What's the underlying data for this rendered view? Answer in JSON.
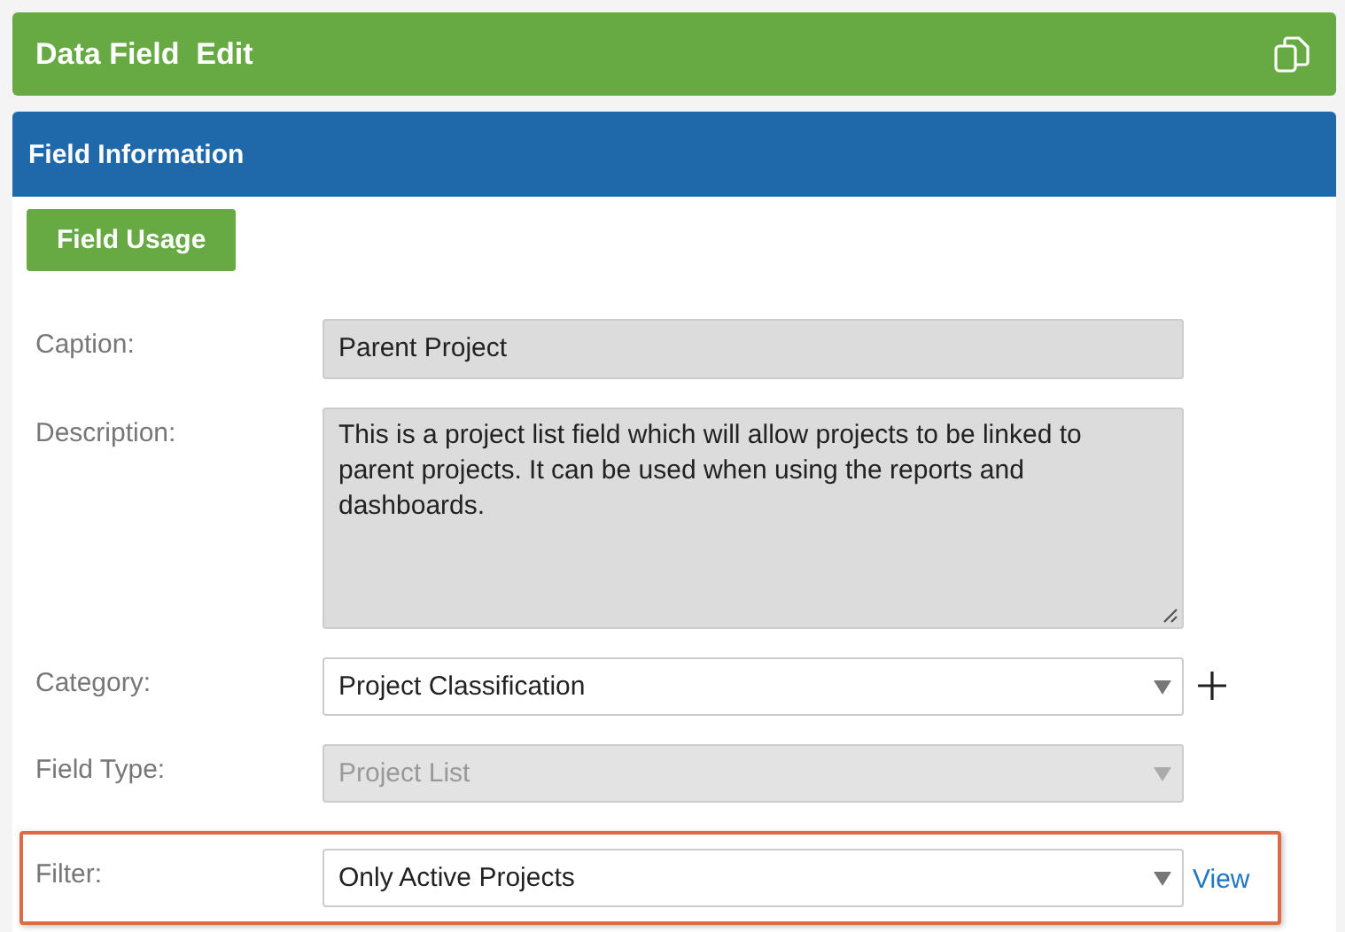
{
  "header": {
    "title": "Data Field  Edit"
  },
  "panel": {
    "title": "Field Information",
    "button": "Field Usage"
  },
  "fields": [
    {
      "label": "Caption:",
      "kind": "text",
      "value": "Parent Project",
      "readonly": true,
      "disabled": false,
      "highlighted": false
    },
    {
      "label": "Description:",
      "kind": "textarea",
      "value": "This is a project list field which will allow projects to be linked to parent projects. It can be used when using the reports and dashboards.",
      "readonly": true,
      "disabled": false,
      "highlighted": false
    },
    {
      "label": "Category:",
      "kind": "select",
      "value": "Project Classification",
      "readonly": false,
      "disabled": false,
      "highlighted": false,
      "action": {
        "kind": "add"
      }
    },
    {
      "label": "Field Type:",
      "kind": "select",
      "value": "Project List",
      "readonly": false,
      "disabled": true,
      "highlighted": false
    },
    {
      "label": "Filter:",
      "kind": "select",
      "value": "Only Active Projects",
      "readonly": false,
      "disabled": false,
      "highlighted": true,
      "action": {
        "kind": "link",
        "label": "View"
      }
    }
  ]
}
